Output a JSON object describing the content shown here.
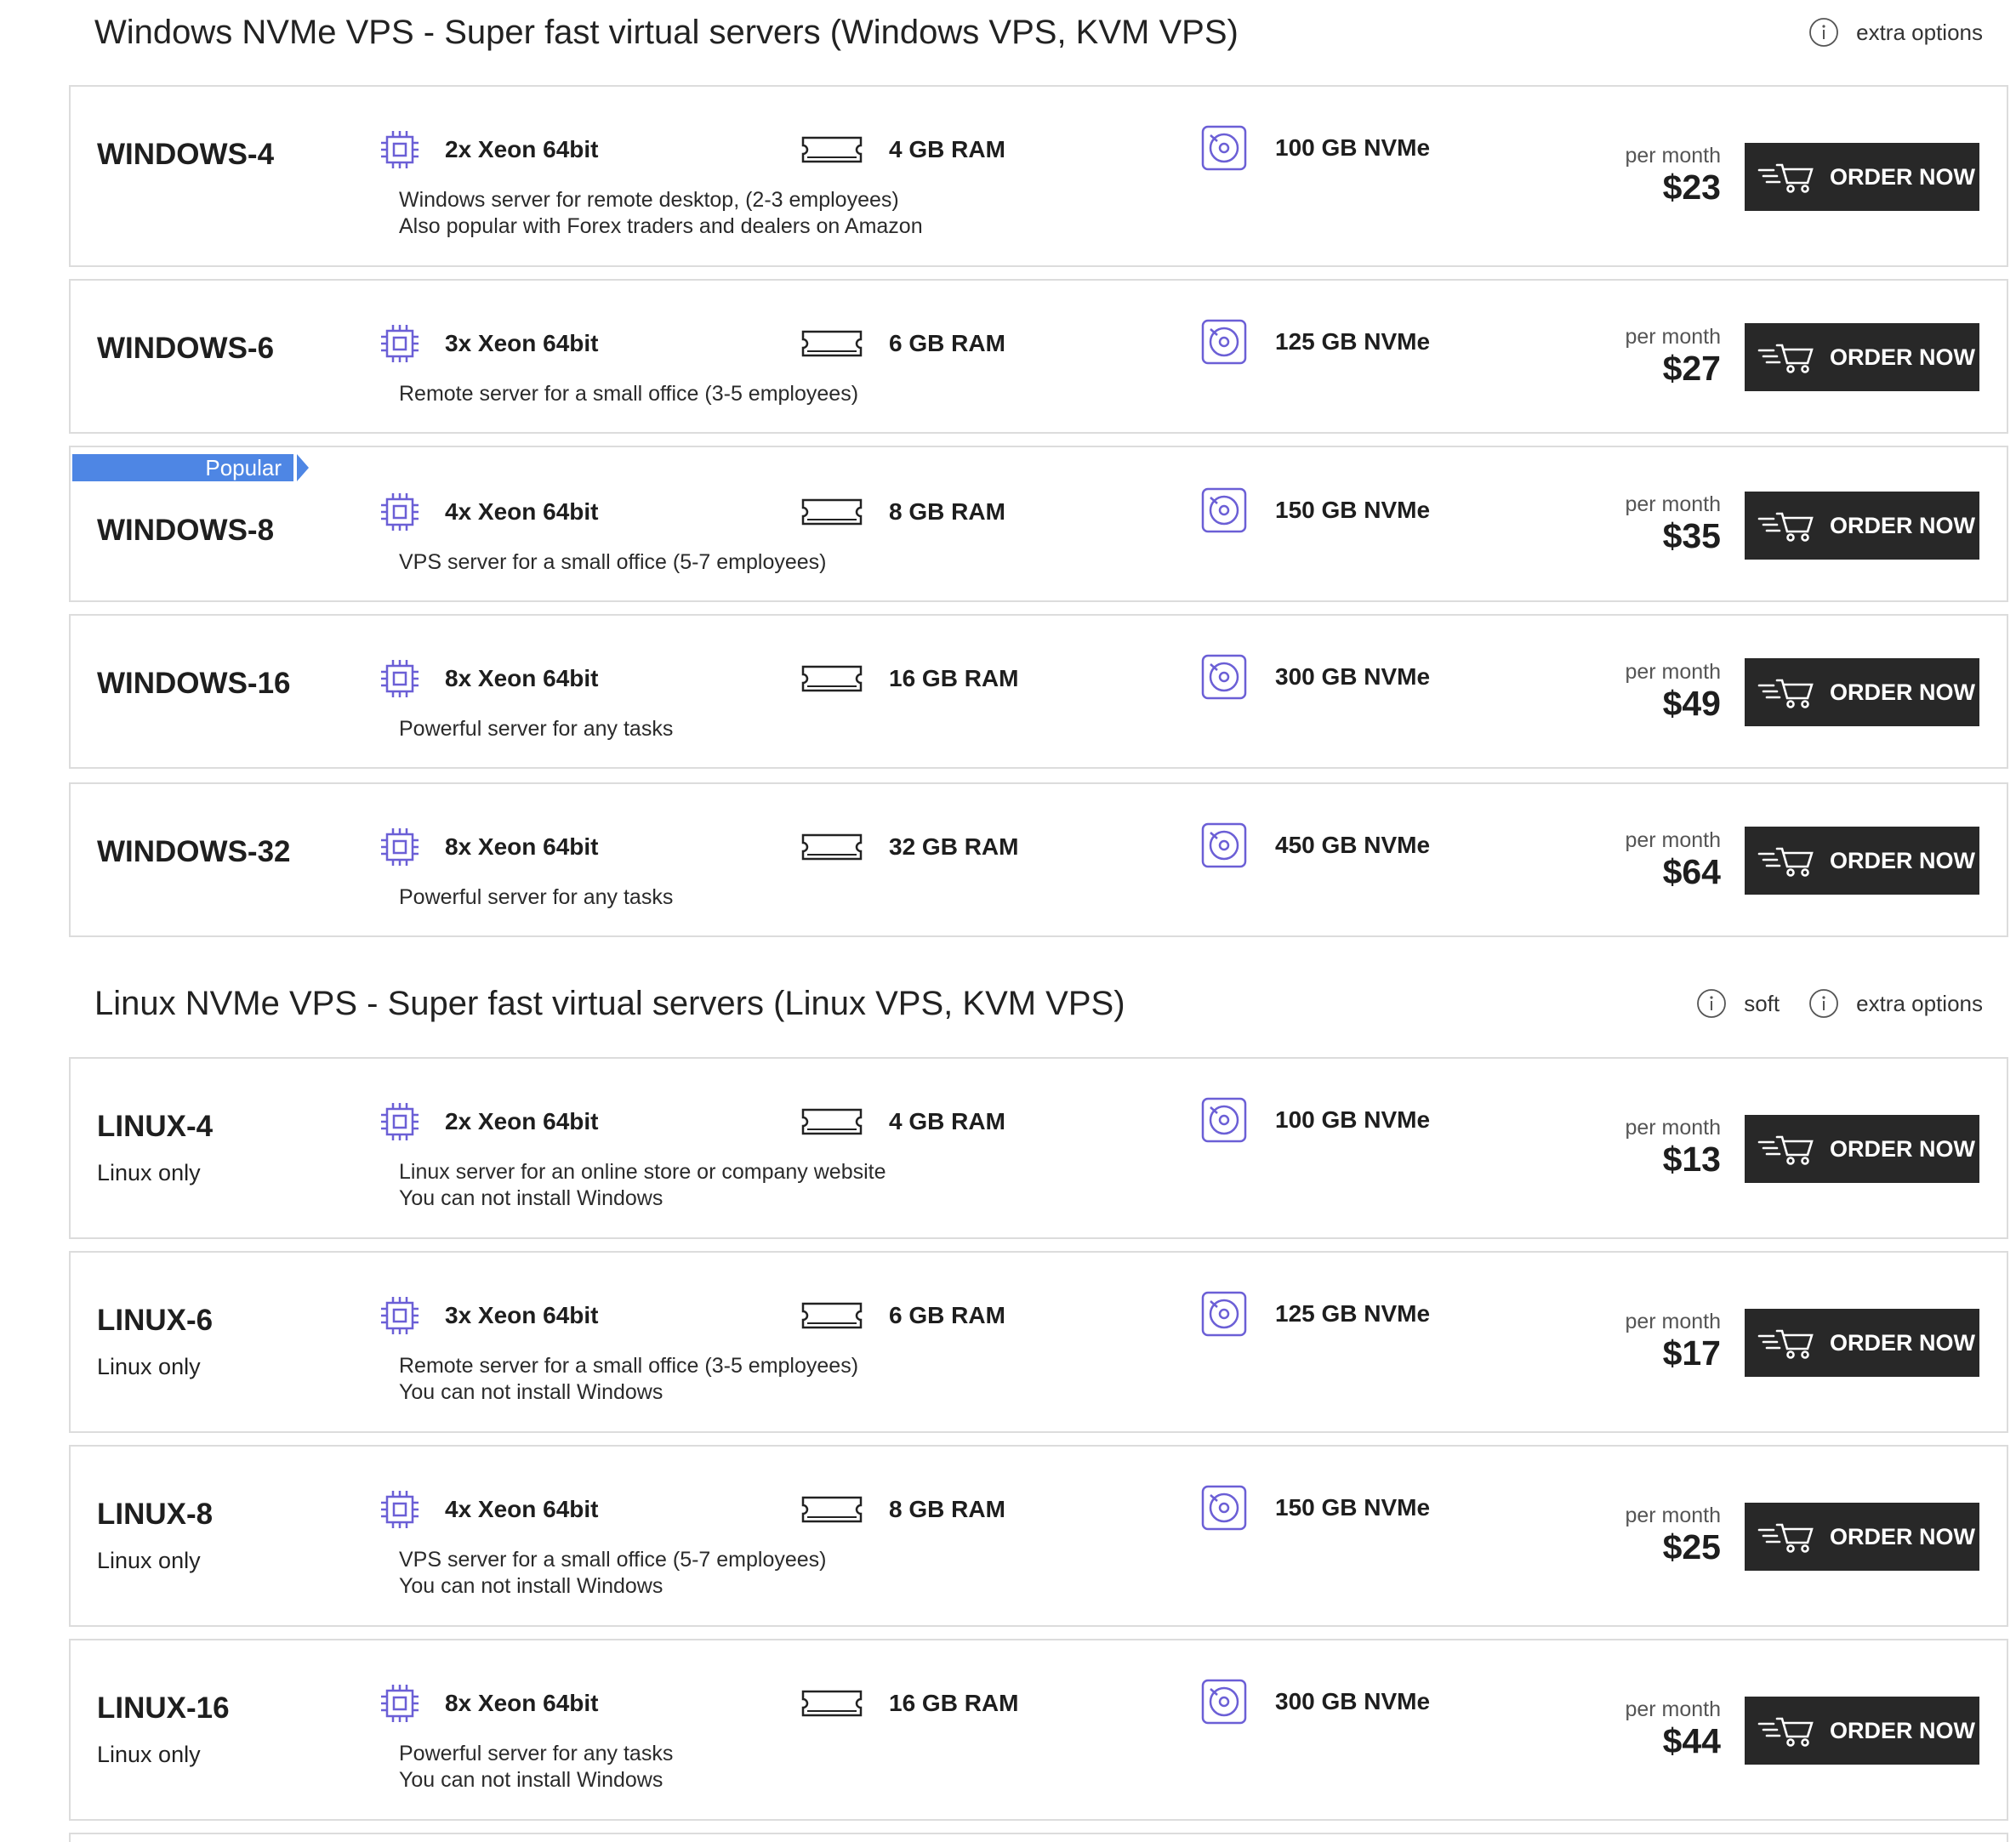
{
  "sections": [
    {
      "title": "Windows NVMe VPS - Super fast virtual servers (Windows VPS, KVM VPS)",
      "links": [
        "extra options"
      ]
    },
    {
      "title": "Linux NVMe VPS - Super fast virtual servers (Linux VPS, KVM VPS)",
      "links": [
        "soft",
        "extra options"
      ]
    }
  ],
  "icons": {
    "cpu": "cpu-icon",
    "ram": "ram-icon",
    "disk": "disk-icon",
    "cart": "cart-icon",
    "info": "info-icon"
  },
  "colors": {
    "icon_accent": "#6b5fd6",
    "button_bg": "#282828",
    "ribbon": "#4e86e4"
  },
  "ui": {
    "per_month": "per month",
    "order_label": "ORDER NOW",
    "popular_label": "Popular"
  },
  "windows_plans": [
    {
      "name": "WINDOWS-4",
      "cpu": "2x Xeon 64bit",
      "ram": "4 GB RAM",
      "disk": "100 GB NVMe",
      "desc": [
        "Windows server for remote desktop, (2-3 employees)",
        "Also popular with Forex traders and dealers on Amazon"
      ],
      "price": "$23"
    },
    {
      "name": "WINDOWS-6",
      "cpu": "3x Xeon 64bit",
      "ram": "6 GB RAM",
      "disk": "125 GB NVMe",
      "desc": [
        "Remote server for a small office (3-5 employees)"
      ],
      "price": "$27"
    },
    {
      "name": "WINDOWS-8",
      "cpu": "4x Xeon 64bit",
      "ram": "8 GB RAM",
      "disk": "150 GB NVMe",
      "desc": [
        "VPS server for a small office (5-7 employees)"
      ],
      "price": "$35"
    },
    {
      "name": "WINDOWS-16",
      "cpu": "8x Xeon 64bit",
      "ram": "16 GB RAM",
      "disk": "300 GB NVMe",
      "desc": [
        "Powerful server for any tasks"
      ],
      "price": "$49"
    },
    {
      "name": "WINDOWS-32",
      "cpu": "8x Xeon 64bit",
      "ram": "32 GB RAM",
      "disk": "450 GB NVMe",
      "desc": [
        "Powerful server for any tasks"
      ],
      "price": "$64"
    }
  ],
  "linux_plans": [
    {
      "name": "LINUX-4",
      "sub": "Linux only",
      "cpu": "2x Xeon 64bit",
      "ram": "4 GB RAM",
      "disk": "100 GB NVMe",
      "desc": [
        "Linux server for an online store or company website",
        "You can not install Windows"
      ],
      "price": "$13"
    },
    {
      "name": "LINUX-6",
      "sub": "Linux only",
      "cpu": "3x Xeon 64bit",
      "ram": "6 GB RAM",
      "disk": "125 GB NVMe",
      "desc": [
        "Remote server for a small office (3-5 employees)",
        "You can not install Windows"
      ],
      "price": "$17"
    },
    {
      "name": "LINUX-8",
      "sub": "Linux only",
      "cpu": "4x Xeon 64bit",
      "ram": "8 GB RAM",
      "disk": "150 GB NVMe",
      "desc": [
        "VPS server for a small office (5-7 employees)",
        "You can not install Windows"
      ],
      "price": "$25"
    },
    {
      "name": "LINUX-16",
      "sub": "Linux only",
      "cpu": "8x Xeon 64bit",
      "ram": "16 GB RAM",
      "disk": "300 GB NVMe",
      "desc": [
        "Powerful server for any tasks",
        "You can not install Windows"
      ],
      "price": "$44"
    }
  ]
}
